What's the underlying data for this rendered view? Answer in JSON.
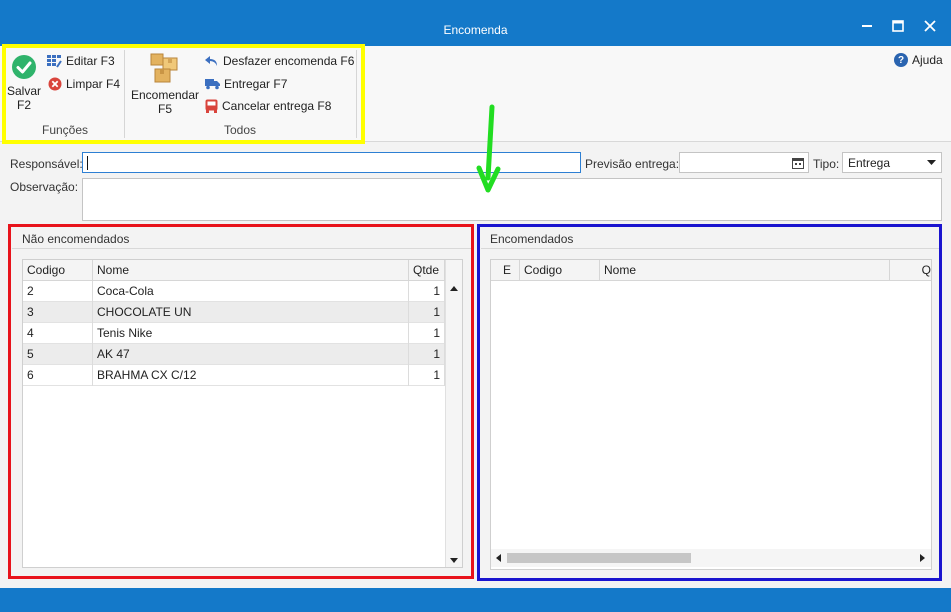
{
  "window": {
    "title": "Encomenda"
  },
  "toolbar": {
    "salvar": "Salvar\nF2",
    "salvar_l1": "Salvar",
    "salvar_l2": "F2",
    "editar": "Editar F3",
    "limpar": "Limpar F4",
    "funcoes_group": "Funções",
    "encomendar_l1": "Encomendar",
    "encomendar_l2": "F5",
    "desfazer": "Desfazer encomenda F6",
    "entregar": "Entregar F7",
    "cancelar": "Cancelar entrega F8",
    "todos_group": "Todos",
    "ajuda": "Ajuda"
  },
  "form": {
    "responsavel_label": "Responsável:",
    "responsavel_value": "",
    "previsao_label": "Previsão entrega:",
    "previsao_value": "",
    "tipo_label": "Tipo:",
    "tipo_value": "Entrega",
    "observacao_label": "Observação:",
    "observacao_value": ""
  },
  "nao_encomendados": {
    "title": "Não encomendados",
    "columns": [
      "Codigo",
      "Nome",
      "Qtde"
    ],
    "rows": [
      {
        "codigo": "2",
        "nome": "Coca-Cola",
        "qtde": "1"
      },
      {
        "codigo": "3",
        "nome": "CHOCOLATE UN",
        "qtde": "1"
      },
      {
        "codigo": "4",
        "nome": "Tenis Nike",
        "qtde": "1"
      },
      {
        "codigo": "5",
        "nome": "AK 47",
        "qtde": "1"
      },
      {
        "codigo": "6",
        "nome": "BRAHMA CX C/12",
        "qtde": "1"
      }
    ]
  },
  "encomendados": {
    "title": "Encomendados",
    "columns": [
      "E",
      "Codigo",
      "Nome",
      "Q"
    ],
    "rows": []
  },
  "colors": {
    "titlebar": "#1479c9",
    "highlight_yellow": "#ffff00",
    "highlight_red": "#e8131b",
    "highlight_blue": "#1a14cf",
    "arrow_green": "#22dd22"
  },
  "icons": {
    "salvar": "check-circle-icon",
    "editar": "grid-edit-icon",
    "limpar": "clear-x-icon",
    "encomendar": "boxes-icon",
    "desfazer": "undo-arrow-icon",
    "entregar": "truck-icon",
    "cancelar": "cancel-bus-icon",
    "ajuda": "help-icon",
    "previsao": "calendar-icon",
    "tipo": "chevron-down-icon"
  }
}
